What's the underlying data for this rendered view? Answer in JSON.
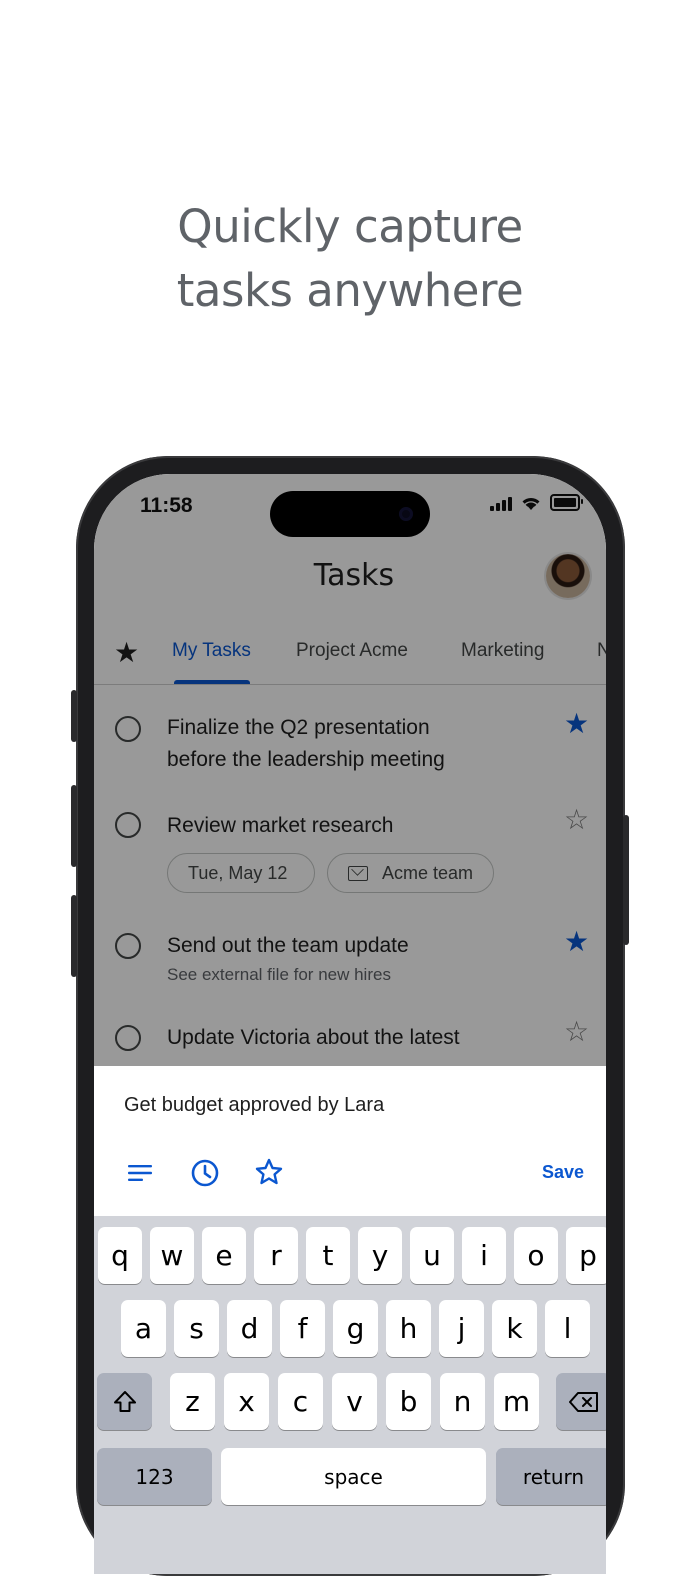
{
  "promo": {
    "line1": "Quickly capture",
    "line2": "tasks anywhere"
  },
  "status_bar": {
    "time": "11:58"
  },
  "app": {
    "title": "Tasks"
  },
  "tabs": {
    "starred_icon": "star-icon",
    "items": [
      {
        "label": "My Tasks",
        "active": true
      },
      {
        "label": "Project Acme",
        "active": false
      },
      {
        "label": "Marketing",
        "active": false
      },
      {
        "label": "N",
        "active": false
      }
    ]
  },
  "tasks": [
    {
      "title_line1": "Finalize the Q2 presentation",
      "title_line2": "before the leadership meeting",
      "starred": true
    },
    {
      "title_line1": "Review market research",
      "starred": false,
      "chips": [
        {
          "label": "Tue, May 12"
        },
        {
          "label": "Acme team",
          "icon": "mail-icon"
        }
      ]
    },
    {
      "title_line1": "Send out the team update",
      "subtitle": "See external file for new hires",
      "starred": true
    },
    {
      "title_line1": "Update Victoria about the latest",
      "starred": false
    }
  ],
  "new_task": {
    "input_value": "Get budget approved by Lara",
    "icons": [
      "details-icon",
      "clock-icon",
      "star-outline-icon"
    ],
    "save_label": "Save"
  },
  "keyboard": {
    "row1": [
      "q",
      "w",
      "e",
      "r",
      "t",
      "y",
      "u",
      "i",
      "o",
      "p"
    ],
    "row2": [
      "a",
      "s",
      "d",
      "f",
      "g",
      "h",
      "j",
      "k",
      "l"
    ],
    "row3": [
      "z",
      "x",
      "c",
      "v",
      "b",
      "n",
      "m"
    ],
    "numbers_label": "123",
    "space_label": "space",
    "return_label": "return"
  },
  "colors": {
    "accent": "#0b57d0",
    "headline": "#5f6368",
    "keyboard_bg": "#d1d3d9"
  }
}
